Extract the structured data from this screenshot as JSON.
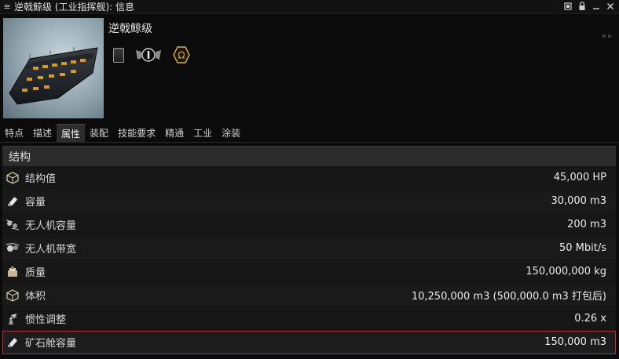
{
  "window": {
    "title": "逆戟鲸级 (工业指挥舰): 信息",
    "menu_glyph": "≡",
    "controls": {
      "pin": "⊡",
      "lock": "🔒",
      "minimize": "−",
      "close": "×"
    }
  },
  "header": {
    "ship_name": "逆戟鲸级",
    "collapse": "«  »",
    "badges": [
      "card-icon",
      "skill-level-icon",
      "omega-icon"
    ],
    "omega_glyph": "Ω"
  },
  "tabs": [
    {
      "label": "特点",
      "active": false
    },
    {
      "label": "描述",
      "active": false
    },
    {
      "label": "属性",
      "active": true
    },
    {
      "label": "装配",
      "active": false
    },
    {
      "label": "技能要求",
      "active": false
    },
    {
      "label": "精通",
      "active": false
    },
    {
      "label": "工业",
      "active": false
    },
    {
      "label": "涂装",
      "active": false
    }
  ],
  "attributes": {
    "section_title": "结构",
    "rows": [
      {
        "label": "结构值",
        "value": "45,000 HP",
        "icon": "structure-hp-icon"
      },
      {
        "label": "容量",
        "value": "30,000 m3",
        "icon": "cargo-capacity-icon"
      },
      {
        "label": "无人机容量",
        "value": "200 m3",
        "icon": "drone-capacity-icon"
      },
      {
        "label": "无人机带宽",
        "value": "50 Mbit/s",
        "icon": "drone-bandwidth-icon"
      },
      {
        "label": "质量",
        "value": "150,000,000 kg",
        "icon": "mass-icon"
      },
      {
        "label": "体积",
        "value": "10,250,000 m3 (500,000.0 m3 打包后)",
        "icon": "volume-icon"
      },
      {
        "label": "惯性调整",
        "value": "0.26 x",
        "icon": "inertia-icon"
      },
      {
        "label": "矿石舱容量",
        "value": "150,000 m3",
        "icon": "ore-hold-icon",
        "highlighted": true
      }
    ]
  },
  "colors": {
    "background": "#0b0b0b",
    "highlight_border": "#b63333",
    "omega_gold": "#e0b040"
  }
}
